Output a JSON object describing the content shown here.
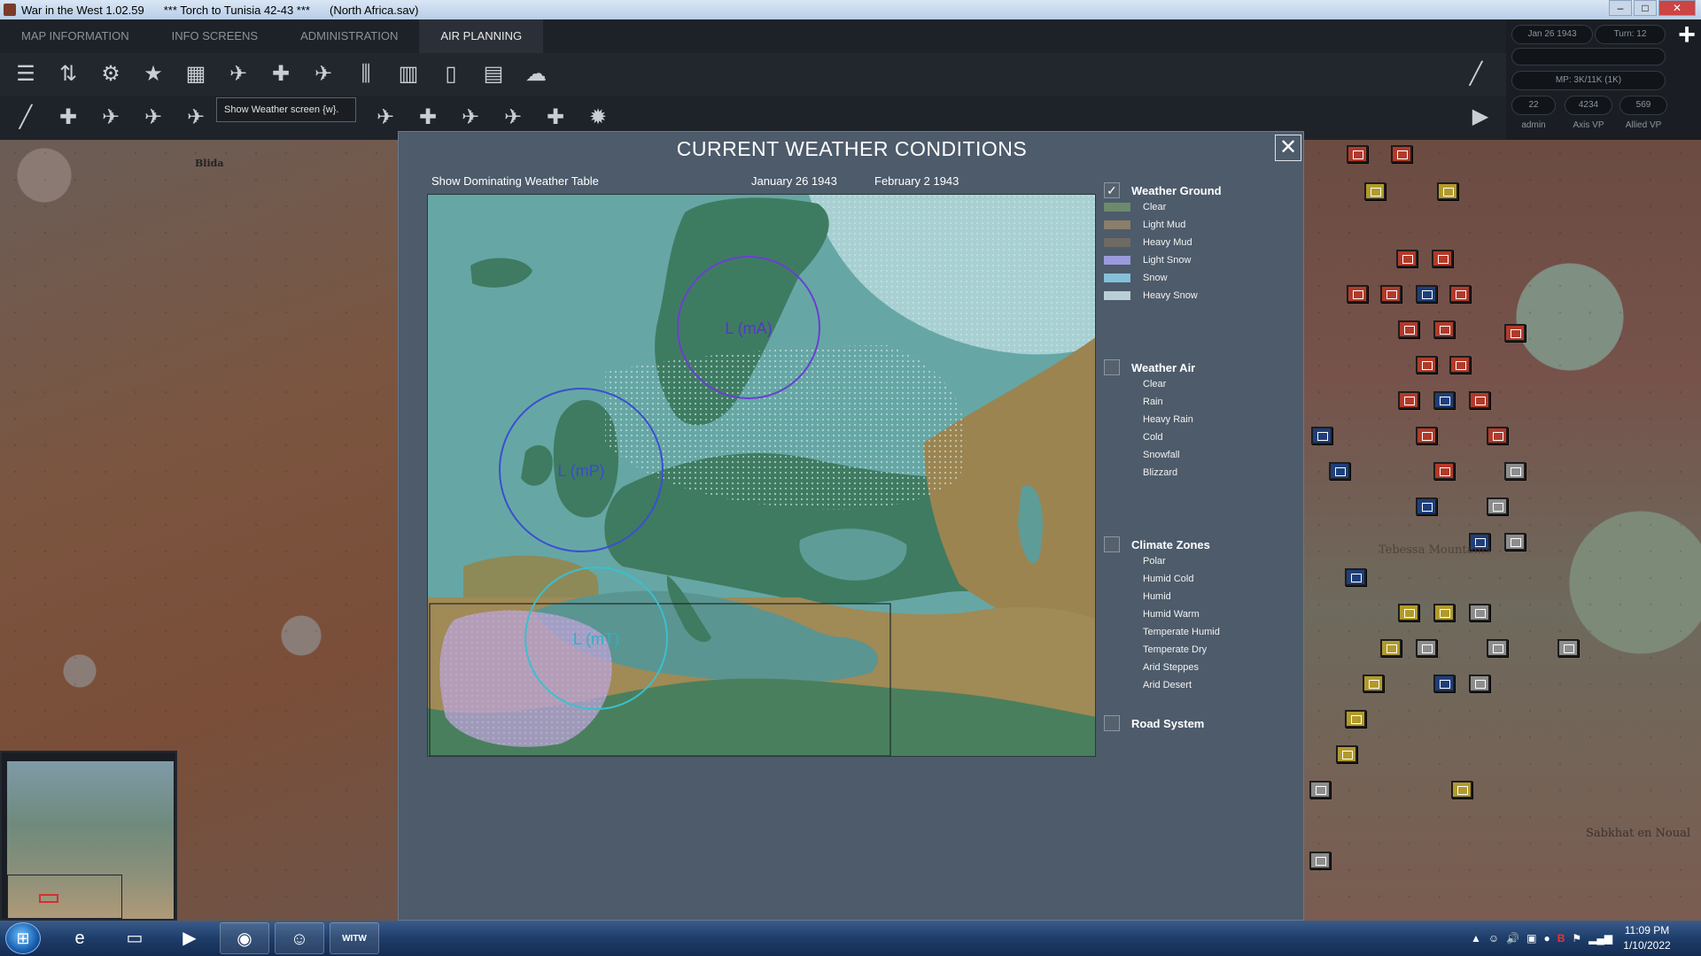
{
  "window": {
    "title": "War in the West  1.02.59",
    "scenario": "***  Torch to Tunisia 42-43  ***",
    "savefile": "(North Africa.sav)"
  },
  "menu": {
    "tabs": [
      {
        "label": "MAP INFORMATION"
      },
      {
        "label": "INFO SCREENS"
      },
      {
        "label": "ADMINISTRATION"
      },
      {
        "label": "AIR PLANNING"
      }
    ]
  },
  "tooltip": "Show Weather screen {w}.",
  "status": {
    "date": "Jan 26 1943",
    "turn": "Turn: 12",
    "mp": "MP: 3K/11K (1K)",
    "admin_value": "22",
    "axis_vp": "4234",
    "allied_vp": "569",
    "admin_label": "admin",
    "axis_label": "Axis VP",
    "allied_label": "Allied VP"
  },
  "map_labels": {
    "blida": "Blida",
    "tebessa": "Tebessa Mountains",
    "sabkhat": "Sabkhat en Noual"
  },
  "dialog": {
    "title": "CURRENT WEATHER CONDITIONS",
    "dominating_link": "Show Dominating Weather Table",
    "date_from": "January  26  1943",
    "date_to": "February  2  1943",
    "pressure_systems": [
      {
        "label": "L (mA)",
        "color": "#6a3fd0"
      },
      {
        "label": "L (mP)",
        "color": "#3b4fd0"
      },
      {
        "label": "L (mT)",
        "color": "#39c0cf"
      }
    ]
  },
  "legend": {
    "weather_ground": {
      "title": "Weather Ground",
      "checked": true,
      "items": [
        {
          "label": "Clear",
          "color": "#6d8a6c"
        },
        {
          "label": "Light Mud",
          "color": "#8a7f6a"
        },
        {
          "label": "Heavy Mud",
          "color": "#6e6a64"
        },
        {
          "label": "Light Snow",
          "color": "#9a9adc"
        },
        {
          "label": "Snow",
          "color": "#86c0d8"
        },
        {
          "label": "Heavy Snow",
          "color": "#b9cfd6"
        }
      ]
    },
    "weather_air": {
      "title": "Weather Air",
      "checked": false,
      "items": [
        "Clear",
        "Rain",
        "Heavy Rain",
        "Cold",
        "Snowfall",
        "Blizzard"
      ]
    },
    "climate_zones": {
      "title": "Climate Zones",
      "checked": false,
      "items": [
        "Polar",
        "Humid Cold",
        "Humid",
        "Humid Warm",
        "Temperate Humid",
        "Temperate Dry",
        "Arid Steppes",
        "Arid Desert"
      ]
    },
    "road_system": {
      "title": "Road System",
      "checked": false
    }
  },
  "taskbar": {
    "apps": [
      "start-orb-icon",
      "internet-explorer-icon",
      "file-explorer-icon",
      "media-player-icon",
      "chrome-icon",
      "discord-icon",
      "witw-icon"
    ],
    "witw_label": "WITW",
    "time": "11:09 PM",
    "date": "1/10/2022"
  }
}
